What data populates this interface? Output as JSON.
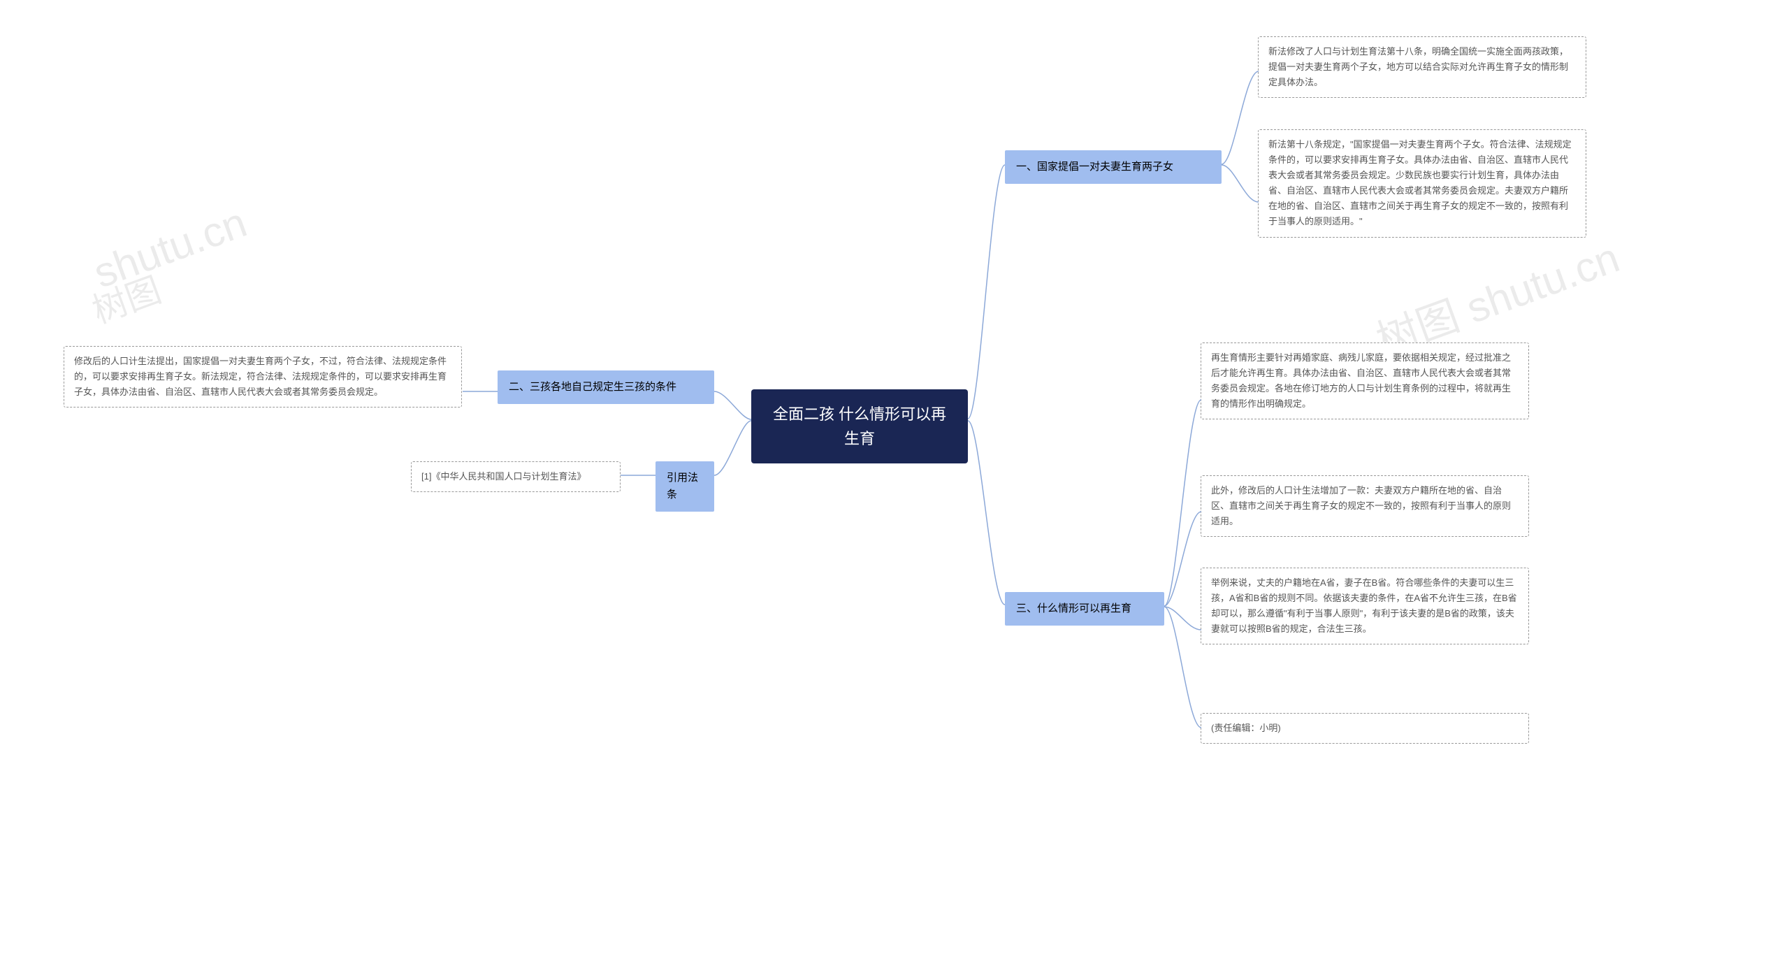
{
  "watermarks": {
    "wm1": "shutu.cn",
    "wm2": "树图 shutu.cn",
    "wm3": "树图"
  },
  "center": {
    "title_line1": "全面二孩 什么情形可以再",
    "title_line2": "生育"
  },
  "left": {
    "topic2": "二、三孩各地自己规定生三孩的条件",
    "topic2_detail": "修改后的人口计生法提出，国家提倡一对夫妻生育两个子女，不过，符合法律、法规规定条件的，可以要求安排再生育子女。新法规定，符合法律、法规规定条件的，可以要求安排再生育子女，具体办法由省、自治区、直辖市人民代表大会或者其常务委员会规定。",
    "topic_ref": "引用法条",
    "topic_ref_detail": "[1]《中华人民共和国人口与计划生育法》"
  },
  "right": {
    "topic1": "一、国家提倡一对夫妻生育两子女",
    "topic1_detail1": "新法修改了人口与计划生育法第十八条，明确全国统一实施全面两孩政策，提倡一对夫妻生育两个子女，地方可以结合实际对允许再生育子女的情形制定具体办法。",
    "topic1_detail2": "新法第十八条规定，\"国家提倡一对夫妻生育两个子女。符合法律、法规规定条件的，可以要求安排再生育子女。具体办法由省、自治区、直辖市人民代表大会或者其常务委员会规定。少数民族也要实行计划生育，具体办法由省、自治区、直辖市人民代表大会或者其常务委员会规定。夫妻双方户籍所在地的省、自治区、直辖市之间关于再生育子女的规定不一致的，按照有利于当事人的原则适用。\"",
    "topic3": "三、什么情形可以再生育",
    "topic3_detail1": "再生育情形主要针对再婚家庭、病残儿家庭，要依据相关规定，经过批准之后才能允许再生育。具体办法由省、自治区、直辖市人民代表大会或者其常务委员会规定。各地在修订地方的人口与计划生育条例的过程中，将就再生育的情形作出明确规定。",
    "topic3_detail2": "此外，修改后的人口计生法增加了一款：夫妻双方户籍所在地的省、自治区、直辖市之间关于再生育子女的规定不一致的，按照有利于当事人的原则适用。",
    "topic3_detail3": "举例来说，丈夫的户籍地在A省，妻子在B省。符合哪些条件的夫妻可以生三孩，A省和B省的规则不同。依据该夫妻的条件，在A省不允许生三孩，在B省却可以，那么遵循\"有利于当事人原则\"，有利于该夫妻的是B省的政策，该夫妻就可以按照B省的规定，合法生三孩。",
    "topic3_detail4": "(责任编辑：小明)"
  }
}
